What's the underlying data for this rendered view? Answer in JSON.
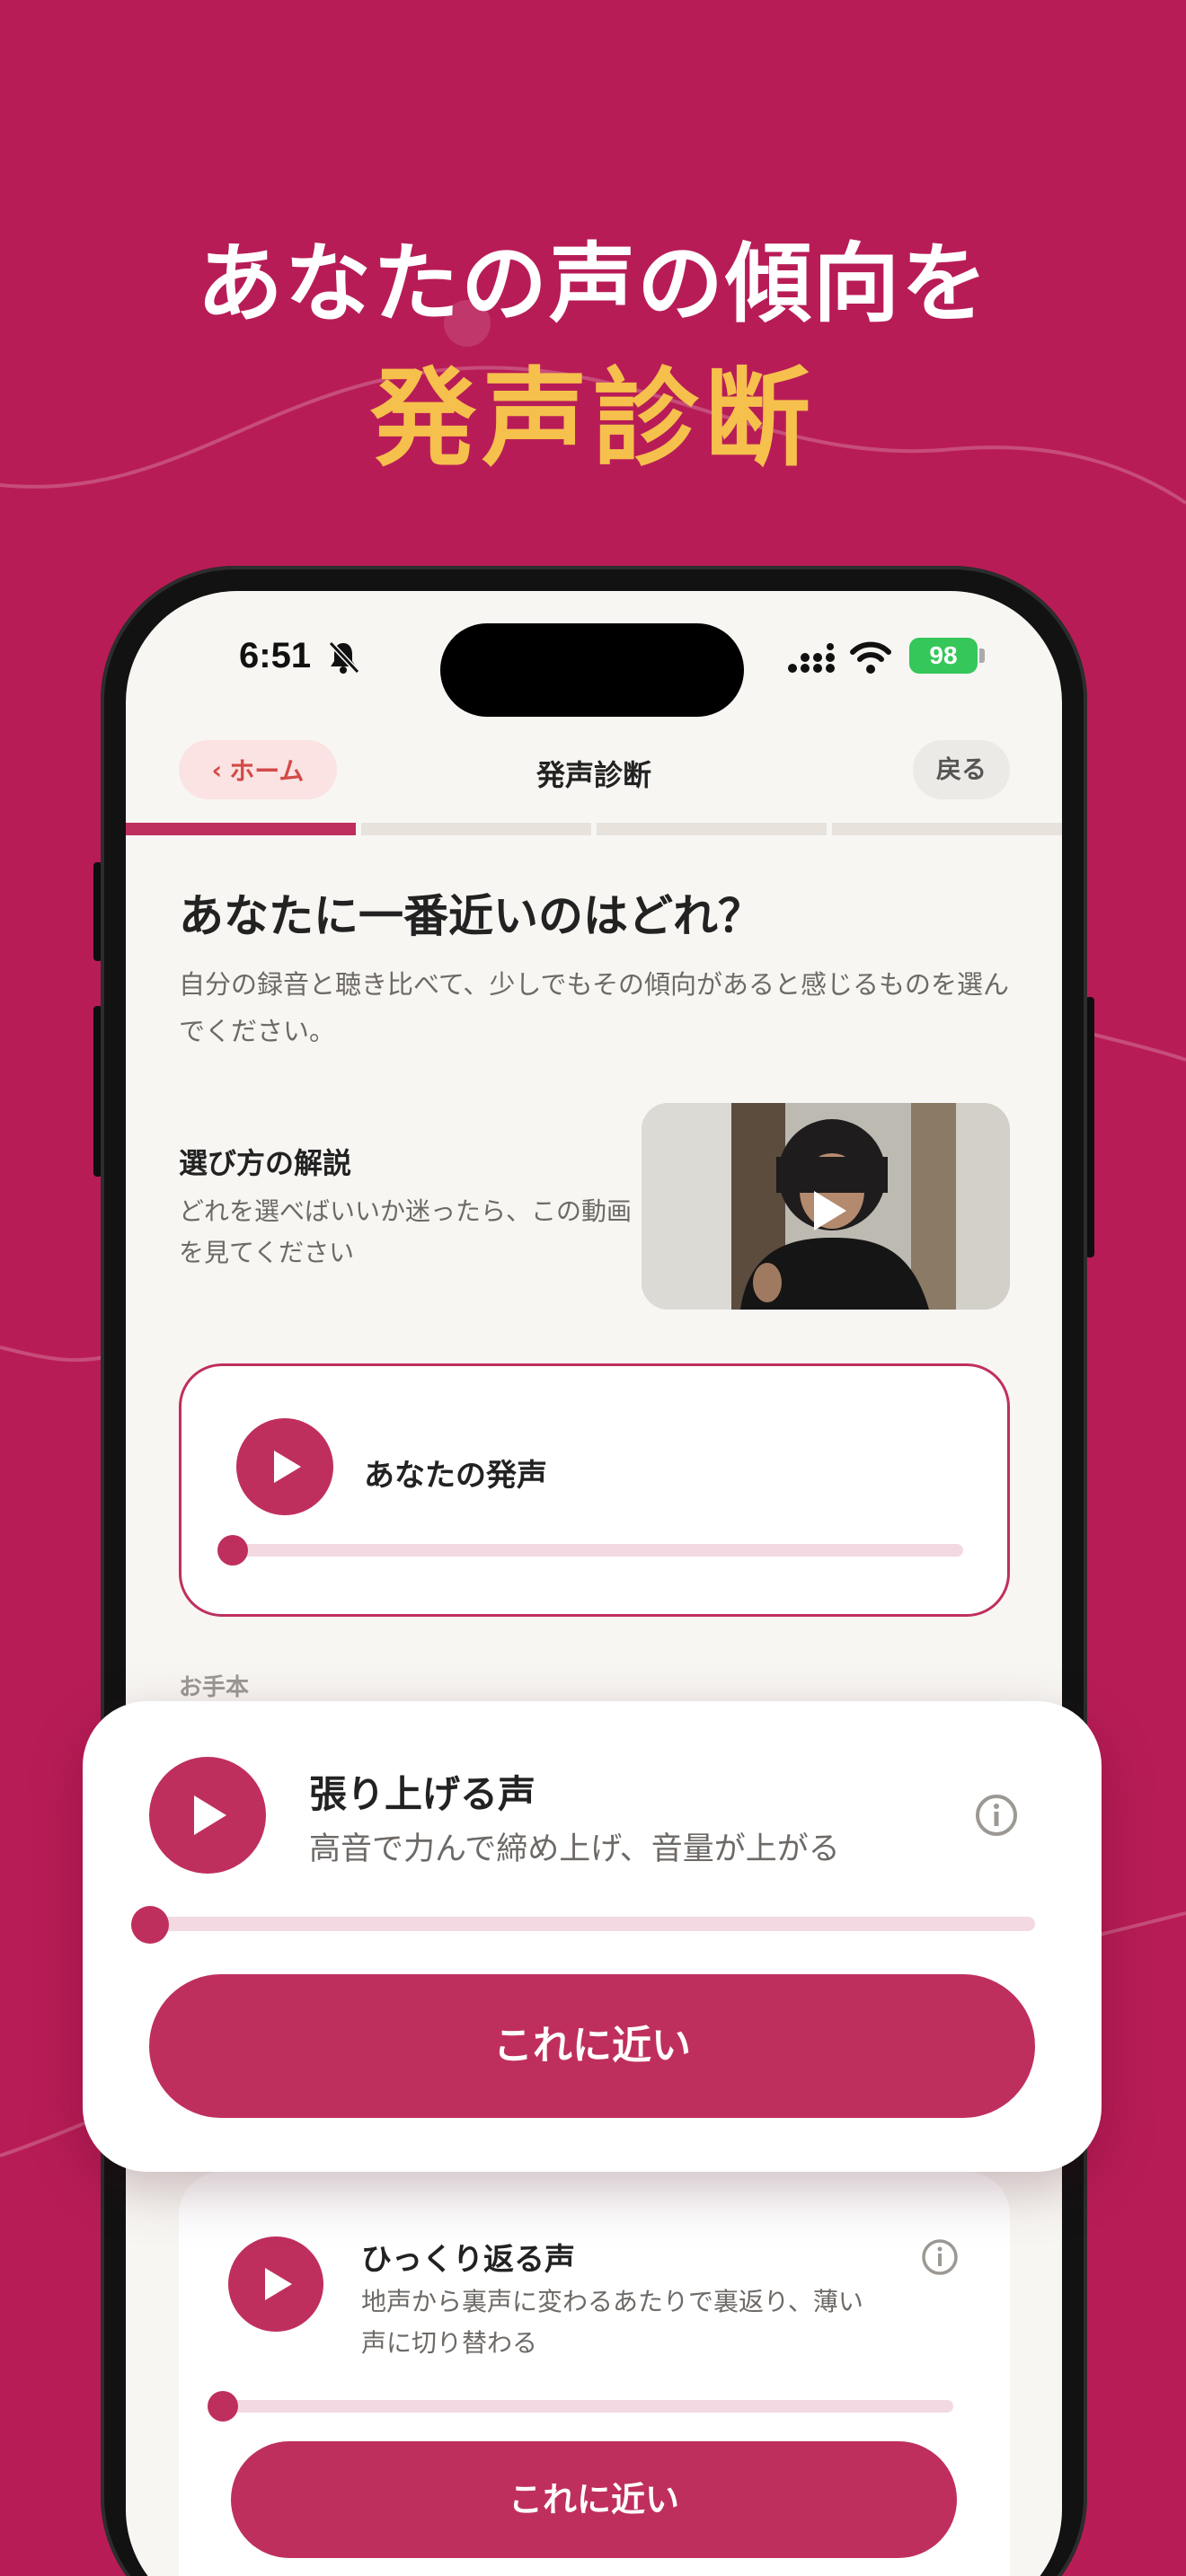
{
  "headline": {
    "line1": "あなたの声の傾向を",
    "line2": "発声診断"
  },
  "status_bar": {
    "time": "6:51",
    "battery": "98"
  },
  "nav": {
    "home_label": "ホーム",
    "title": "発声診断",
    "back_label": "戻る"
  },
  "progress": {
    "current_step": 1,
    "total_steps": 4
  },
  "question": {
    "title": "あなたに一番近いのはどれ？",
    "subtitle": "自分の録音と聴き比べて、少しでもその傾向があると感じるものを選んでください。"
  },
  "guide": {
    "title": "選び方の解説",
    "text": "どれを選べばいいか迷ったら、この動画を見てください"
  },
  "your_voice": {
    "label": "あなたの発声",
    "playback_progress": 0
  },
  "samples_label": "お手本",
  "options": [
    {
      "title": "張り上げる声",
      "description": "高音で力んで締め上げ、音量が上がる",
      "button_label": "これに近い",
      "playback_progress": 0
    },
    {
      "title": "ひっくり返る声",
      "description": "地声から裏声に変わるあたりで裏返り、薄い声に切り替わる",
      "button_label": "これに近い",
      "playback_progress": 0
    }
  ],
  "colors": {
    "background": "#b81c57",
    "accent": "#bf2f5d",
    "headline_highlight": "#f6c04c",
    "screen_bg": "#f8f6f3"
  },
  "icons": [
    "bell-slash-icon",
    "signal-icon",
    "wifi-icon",
    "battery-icon",
    "chevron-left-icon",
    "play-icon",
    "info-icon"
  ]
}
